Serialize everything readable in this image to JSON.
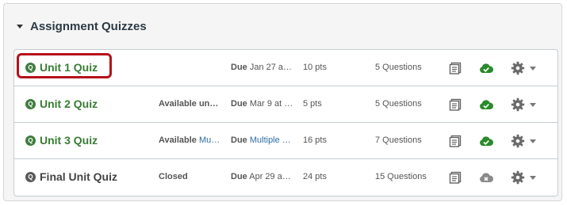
{
  "group": {
    "title": "Assignment Quizzes"
  },
  "quizzes": [
    {
      "badge": "Q",
      "title": "Unit 1 Quiz",
      "availability_label": "",
      "availability_value": "",
      "due_label": "Due",
      "due_value": "Jan 27 a…",
      "points": "10 pts",
      "questions": "5 Questions",
      "published": true
    },
    {
      "badge": "Q",
      "title": "Unit 2 Quiz",
      "availability_label": "Available un…",
      "availability_value": "",
      "due_label": "Due",
      "due_value": "Mar 9 at …",
      "points": "5 pts",
      "questions": "5 Questions",
      "published": true
    },
    {
      "badge": "Q",
      "title": "Unit 3 Quiz",
      "availability_label": "Available",
      "availability_value": "Mu…",
      "due_label": "Due",
      "due_value": "Multiple …",
      "points": "16 pts",
      "questions": "7 Questions",
      "published": true
    },
    {
      "badge": "Q",
      "title": "Final Unit Quiz",
      "availability_label": "Closed",
      "availability_value": "",
      "due_label": "Due",
      "due_value": "Apr 29 a…",
      "points": "24 pts",
      "questions": "15 Questions",
      "published": false
    }
  ],
  "colors": {
    "published_green": "#2a8a2a",
    "unpublished_gray": "#8a8a8a",
    "focus_red": "#b5121b",
    "title_green": "#397c33",
    "link_blue": "#2d6fa4"
  },
  "icons": {
    "group_toggle": "caret-down-icon",
    "quiz_type": "quiz-icon",
    "document": "document-icon",
    "publish": "cloud-check-icon",
    "unpublish": "cloud-x-icon",
    "settings": "gear-icon",
    "menu": "caret-down-icon"
  }
}
